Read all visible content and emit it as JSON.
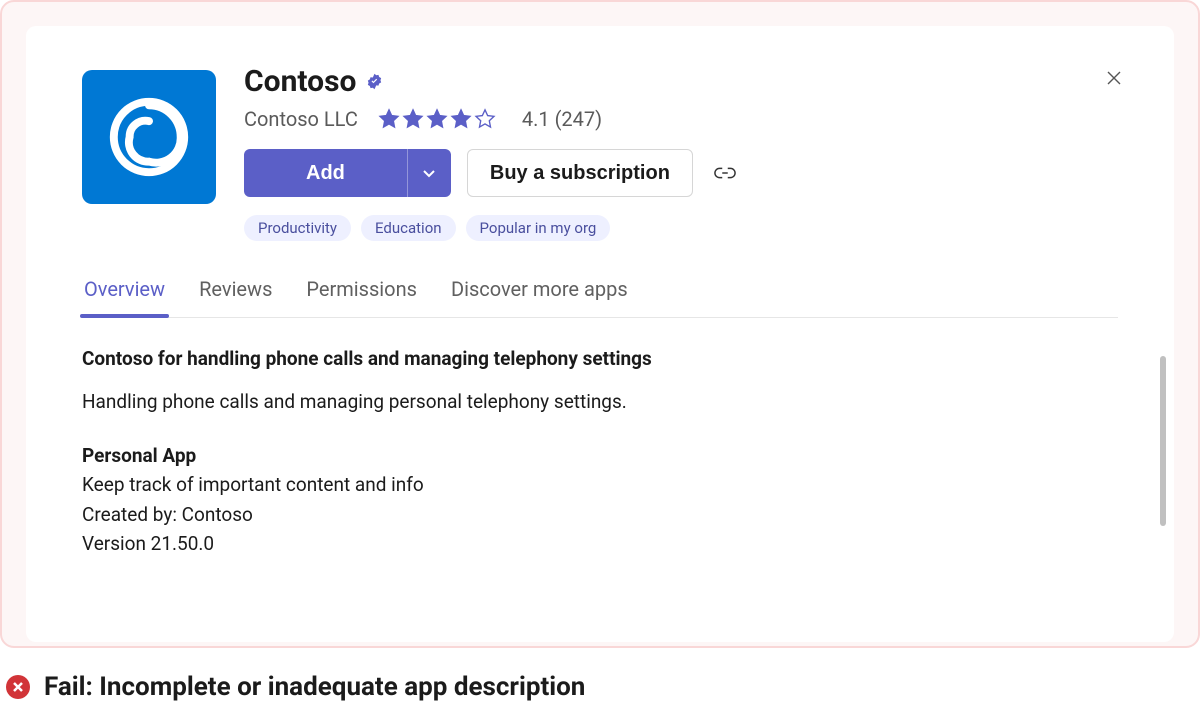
{
  "app": {
    "name": "Contoso",
    "publisher": "Contoso LLC",
    "rating_value": "4.1",
    "rating_count": "(247)",
    "stars_filled": 4,
    "stars_total": 5
  },
  "buttons": {
    "add_label": "Add",
    "buy_label": "Buy a subscription"
  },
  "tags": [
    "Productivity",
    "Education",
    "Popular in my org"
  ],
  "tabs": [
    "Overview",
    "Reviews",
    "Permissions",
    "Discover more apps"
  ],
  "active_tab_index": 0,
  "overview": {
    "headline": "Contoso for handling phone calls and managing telephony settings",
    "summary": "Handling phone calls and managing personal telephony settings.",
    "feature_heading": "Personal App",
    "feature_line": "Keep track of important content and info",
    "created_by_line": "Created by: Contoso",
    "version_line": "Version 21.50.0"
  },
  "fail_message": "Fail: Incomplete or inadequate app description",
  "colors": {
    "accent": "#5b5fc7",
    "logo": "#0078d4",
    "fail": "#d13438"
  }
}
